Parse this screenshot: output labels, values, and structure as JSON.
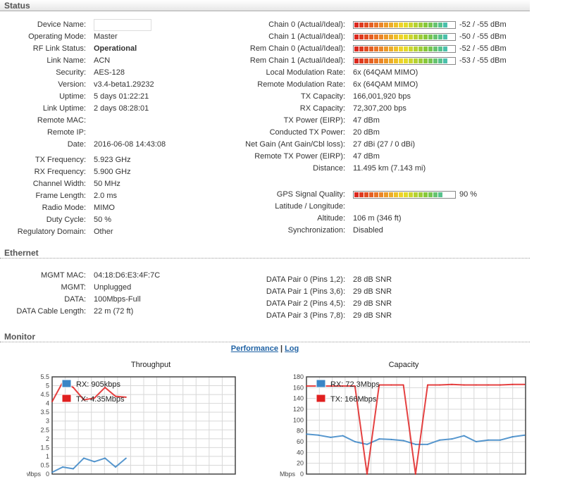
{
  "status": {
    "title": "Status",
    "left": [
      {
        "label": "Device Name:",
        "value": ""
      },
      {
        "label": "Operating Mode:",
        "value": "Master"
      },
      {
        "label": "RF Link Status:",
        "value": "Operational"
      },
      {
        "label": "Link Name:",
        "value": "ACN"
      },
      {
        "label": "Security:",
        "value": "AES-128"
      },
      {
        "label": "Version:",
        "value": "v3.4-beta1.29232"
      },
      {
        "label": "Uptime:",
        "value": "5 days 01:22:21"
      },
      {
        "label": "Link Uptime:",
        "value": "2 days 08:28:01"
      },
      {
        "label": "Remote MAC:",
        "value": ""
      },
      {
        "label": "Remote IP:",
        "value": ""
      },
      {
        "label": "Date:",
        "value": "2016-06-08 14:43:08"
      },
      {
        "label": "TX Frequency:",
        "value": "5.923 GHz"
      },
      {
        "label": "RX Frequency:",
        "value": "5.900 GHz"
      },
      {
        "label": "Channel Width:",
        "value": "50 MHz"
      },
      {
        "label": "Frame Length:",
        "value": "2.0 ms"
      },
      {
        "label": "Radio Mode:",
        "value": "MIMO"
      },
      {
        "label": "Duty Cycle:",
        "value": "50 %"
      },
      {
        "label": "Regulatory Domain:",
        "value": "Other"
      }
    ],
    "chains": [
      {
        "label": "Chain 0 (Actual/Ideal):",
        "value": "-52 / -55 dBm",
        "level": 0.95
      },
      {
        "label": "Chain 1 (Actual/Ideal):",
        "value": "-50 / -55 dBm",
        "level": 0.97
      },
      {
        "label": "Rem Chain 0 (Actual/Ideal):",
        "value": "-52 / -55 dBm",
        "level": 0.95
      },
      {
        "label": "Rem Chain 1 (Actual/Ideal):",
        "value": "-53 / -55 dBm",
        "level": 0.94
      }
    ],
    "right": [
      {
        "label": "Local Modulation Rate:",
        "value": "6x (64QAM MIMO)"
      },
      {
        "label": "Remote Modulation Rate:",
        "value": "6x (64QAM MIMO)"
      },
      {
        "label": "TX Capacity:",
        "value": "166,001,920 bps"
      },
      {
        "label": "RX Capacity:",
        "value": "72,307,200 bps"
      },
      {
        "label": "TX Power (EIRP):",
        "value": "47 dBm"
      },
      {
        "label": "Conducted TX Power:",
        "value": "20 dBm"
      },
      {
        "label": "Net Gain (Ant Gain/Cbl loss):",
        "value": "27 dBi (27 / 0 dBi)"
      },
      {
        "label": "Remote TX Power (EIRP):",
        "value": "47 dBm"
      },
      {
        "label": "Distance:",
        "value": "11.495 km (7.143 mi)"
      }
    ],
    "gps": {
      "label": "GPS Signal Quality:",
      "value": "90 %",
      "level": 0.9
    },
    "right2": [
      {
        "label": "Latitude / Longitude:",
        "value": ""
      },
      {
        "label": "Altitude:",
        "value": "106 m (346 ft)"
      },
      {
        "label": "Synchronization:",
        "value": "Disabled"
      }
    ]
  },
  "ethernet": {
    "title": "Ethernet",
    "left": [
      {
        "label": "MGMT MAC:",
        "value": "04:18:D6:E3:4F:7C"
      },
      {
        "label": "MGMT:",
        "value": "Unplugged"
      },
      {
        "label": "DATA:",
        "value": "100Mbps-Full"
      },
      {
        "label": "DATA Cable Length:",
        "value": "22 m (72 ft)"
      }
    ],
    "right": [
      {
        "label": "DATA Pair 0 (Pins 1,2):",
        "value": "28 dB SNR"
      },
      {
        "label": "DATA Pair 1 (Pins 3,6):",
        "value": "29 dB SNR"
      },
      {
        "label": "DATA Pair 2 (Pins 4,5):",
        "value": "29 dB SNR"
      },
      {
        "label": "DATA Pair 3 (Pins 7,8):",
        "value": "29 dB SNR"
      }
    ]
  },
  "monitor": {
    "title": "Monitor",
    "link_performance": "Performance",
    "link_sep": "|",
    "link_log": "Log"
  },
  "colors": {
    "rx": "#3a85c6",
    "tx": "#e02020",
    "link": "#1f62a4"
  },
  "chart_data": [
    {
      "type": "line",
      "title": "Throughput",
      "unit_label": "Mbps",
      "ylim": [
        0,
        5.5
      ],
      "yticks": [
        "0",
        "0.5",
        "1",
        "1.5",
        "2",
        "2.5",
        "3",
        "3.5",
        "4",
        "4.5",
        "5",
        "5.5"
      ],
      "grid": true,
      "legend": "top-left",
      "series": [
        {
          "name": "RX: 905kbps",
          "color": "#3a85c6",
          "values": [
            0.1,
            0.4,
            0.3,
            0.9,
            0.7,
            0.9,
            0.4,
            0.9
          ]
        },
        {
          "name": "TX: 4.35Mbps",
          "color": "#e02020",
          "values": [
            4.1,
            5.2,
            4.9,
            4.2,
            4.3,
            4.9,
            4.4,
            4.35
          ]
        }
      ]
    },
    {
      "type": "line",
      "title": "Capacity",
      "unit_label": "Mbps",
      "ylim": [
        0,
        180
      ],
      "yticks": [
        "0",
        "20",
        "40",
        "60",
        "80",
        "100",
        "120",
        "140",
        "160",
        "180"
      ],
      "grid": true,
      "legend": "top-left",
      "series": [
        {
          "name": "RX: 72.3Mbps",
          "color": "#3a85c6",
          "values": [
            74,
            72,
            68,
            71,
            60,
            55,
            65,
            64,
            62,
            55,
            55,
            63,
            65,
            71,
            60,
            63,
            63,
            69,
            72
          ]
        },
        {
          "name": "TX: 166Mbps",
          "color": "#e02020",
          "values": [
            163,
            163,
            163,
            163,
            163,
            0,
            165,
            165,
            165,
            0,
            165,
            165,
            166,
            165,
            165,
            165,
            165,
            166,
            166
          ]
        }
      ]
    }
  ]
}
